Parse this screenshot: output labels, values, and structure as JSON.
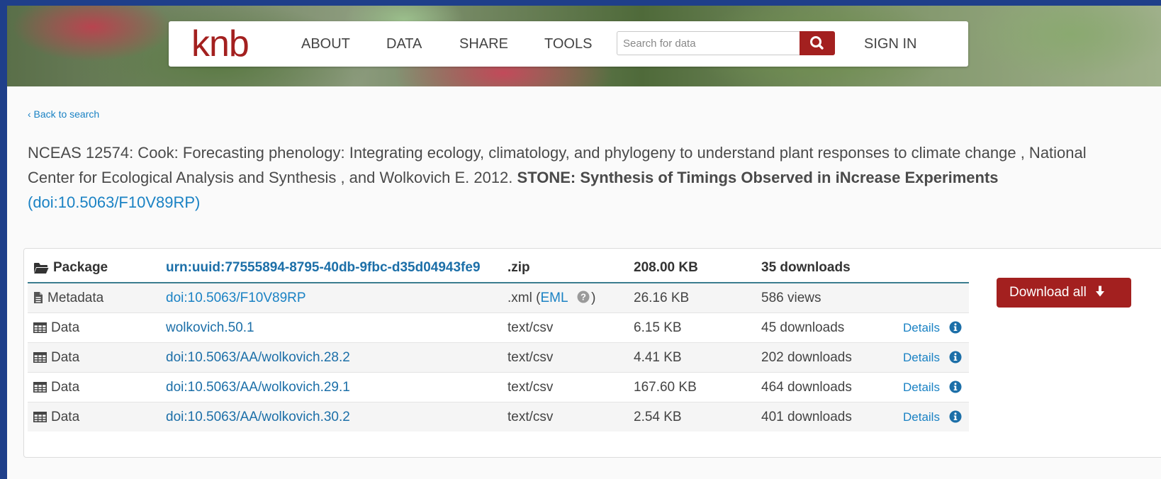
{
  "header": {
    "logo": "knb",
    "nav": [
      "ABOUT",
      "DATA",
      "SHARE",
      "TOOLS"
    ],
    "search_placeholder": "Search for data",
    "sign_in": "SIGN IN"
  },
  "back_link": "‹ Back to search",
  "citation": {
    "authors": "NCEAS 12574: Cook: Forecasting phenology: Integrating ecology, climatology, and phylogeny to understand plant responses to climate change , National Center for Ecological Analysis and Synthesis , and Wolkovich E. 2012.",
    "title": "STONE: Synthesis of Timings Observed in iNcrease Experiments",
    "doi": "(doi:10.5063/F10V89RP)"
  },
  "package": {
    "header": {
      "label": "Package",
      "id": "urn:uuid:77555894-8795-40db-9fbc-d35d04943fe9",
      "format": ".zip",
      "size": "208.00 KB",
      "count": "35 downloads"
    },
    "metadata": {
      "label": "Metadata",
      "id": "doi:10.5063/F10V89RP",
      "format_prefix": ".xml (",
      "format_link": "EML",
      "format_suffix": ")",
      "size": "26.16 KB",
      "count": "586 views"
    },
    "rows": [
      {
        "label": "Data",
        "id": "wolkovich.50.1",
        "format": "text/csv",
        "size": "6.15 KB",
        "count": "45 downloads",
        "details": "Details"
      },
      {
        "label": "Data",
        "id": "doi:10.5063/AA/wolkovich.28.2",
        "format": "text/csv",
        "size": "4.41 KB",
        "count": "202 downloads",
        "details": "Details"
      },
      {
        "label": "Data",
        "id": "doi:10.5063/AA/wolkovich.29.1",
        "format": "text/csv",
        "size": "167.60 KB",
        "count": "464 downloads",
        "details": "Details"
      },
      {
        "label": "Data",
        "id": "doi:10.5063/AA/wolkovich.30.2",
        "format": "text/csv",
        "size": "2.54 KB",
        "count": "401 downloads",
        "details": "Details"
      }
    ]
  },
  "download_all": "Download all",
  "colors": {
    "brand": "#a3201f",
    "link": "#1a82c4",
    "frame": "#1f3f8a"
  }
}
